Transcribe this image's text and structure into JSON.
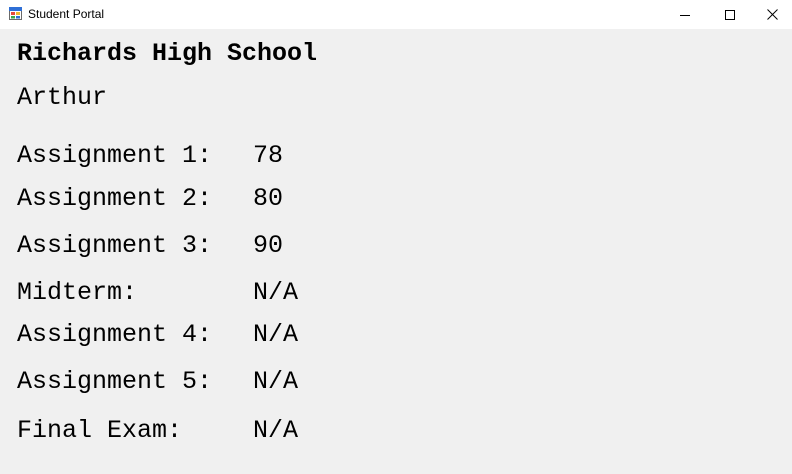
{
  "window": {
    "title": "Student Portal",
    "icon": "winforms-app-icon",
    "controls": {
      "minimize": "minimize-icon",
      "maximize": "maximize-icon",
      "close": "close-icon"
    }
  },
  "header": {
    "school_name": "Richards High School",
    "student_name": "Arthur"
  },
  "grades": [
    {
      "label": "Assignment 1:",
      "value": "78"
    },
    {
      "label": "Assignment 2:",
      "value": "80"
    },
    {
      "label": "Assignment 3:",
      "value": "90"
    },
    {
      "label": "Midterm:",
      "value": "N/A"
    },
    {
      "label": "Assignment 4:",
      "value": "N/A"
    },
    {
      "label": "Assignment 5:",
      "value": "N/A"
    },
    {
      "label": "Final Exam:",
      "value": "N/A"
    }
  ],
  "colors": {
    "titlebar": "#ffffff",
    "client_area": "#f0f0f0",
    "text": "#000000"
  }
}
